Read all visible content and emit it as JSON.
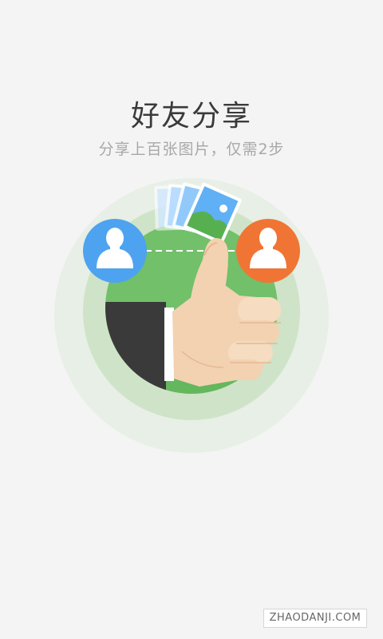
{
  "onboarding": {
    "title": "好友分享",
    "subtitle": "分享上百张图片，仅需2步"
  },
  "illustration": {
    "left_avatar_color": "#4da3f0",
    "right_avatar_color": "#f07535",
    "icons": [
      "user-avatar-icon",
      "photo-stack-icon",
      "thumbs-up-icon"
    ]
  },
  "watermark": {
    "text": "ZHAODANJI.COM"
  }
}
